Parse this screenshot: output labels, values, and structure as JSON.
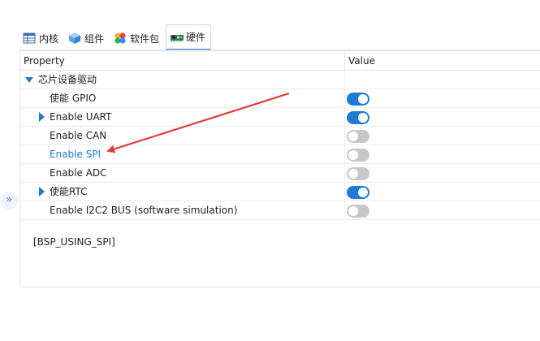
{
  "tabs": [
    {
      "label": "内核",
      "icon": "table-icon",
      "active": false
    },
    {
      "label": "组件",
      "icon": "cube-icon",
      "active": false
    },
    {
      "label": "软件包",
      "icon": "petals-icon",
      "active": false
    },
    {
      "label": "硬件",
      "icon": "board-icon",
      "active": true
    }
  ],
  "grid": {
    "header_property": "Property",
    "header_value": "Value"
  },
  "group": {
    "label": "芯片设备驱动",
    "expanded": true
  },
  "rows": [
    {
      "label": "使能 GPIO",
      "on": true,
      "expandable": false,
      "link": false
    },
    {
      "label": "Enable UART",
      "on": true,
      "expandable": true,
      "link": false
    },
    {
      "label": "Enable CAN",
      "on": false,
      "expandable": false,
      "link": false
    },
    {
      "label": "Enable SPI",
      "on": false,
      "expandable": false,
      "link": true
    },
    {
      "label": "Enable ADC",
      "on": false,
      "expandable": false,
      "link": false
    },
    {
      "label": "使能RTC",
      "on": true,
      "expandable": true,
      "link": false
    },
    {
      "label": "Enable I2C2 BUS (software simulation)",
      "on": false,
      "expandable": false,
      "link": false
    }
  ],
  "description": "[BSP_USING_SPI]",
  "expander_glyph": "»",
  "colors": {
    "accent": "#1e7ad6",
    "toggle_off": "#c7c7c7",
    "annotation_arrow": "#e53935"
  }
}
